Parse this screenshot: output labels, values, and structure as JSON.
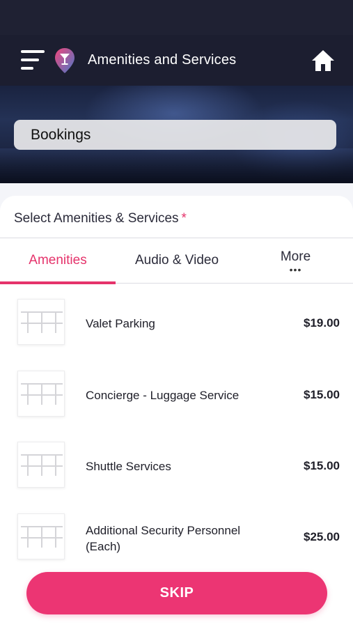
{
  "header": {
    "title": "Amenities and Services",
    "menu_icon": "hamburger-menu-icon",
    "logo_icon": "cocktail-location-pin-icon",
    "home_icon": "home-icon"
  },
  "hero": {
    "bookings_label": "Bookings"
  },
  "section": {
    "title": "Select Amenities & Services",
    "required_mark": "*"
  },
  "tabs": [
    {
      "label": "Amenities",
      "active": true
    },
    {
      "label": "Audio & Video",
      "active": false
    },
    {
      "label": "More",
      "active": false,
      "dots": "•••"
    }
  ],
  "items": [
    {
      "name": "Valet Parking",
      "price": "$19.00"
    },
    {
      "name": "Concierge - Luggage Service",
      "price": "$15.00"
    },
    {
      "name": "Shuttle Services",
      "price": "$15.00"
    },
    {
      "name": "Additional Security Personnel (Each)",
      "price": "$25.00"
    }
  ],
  "footer": {
    "skip_label": "SKIP"
  },
  "colors": {
    "accent": "#ec3573",
    "header_bg": "#1c1e30",
    "text": "#1e1e28"
  }
}
